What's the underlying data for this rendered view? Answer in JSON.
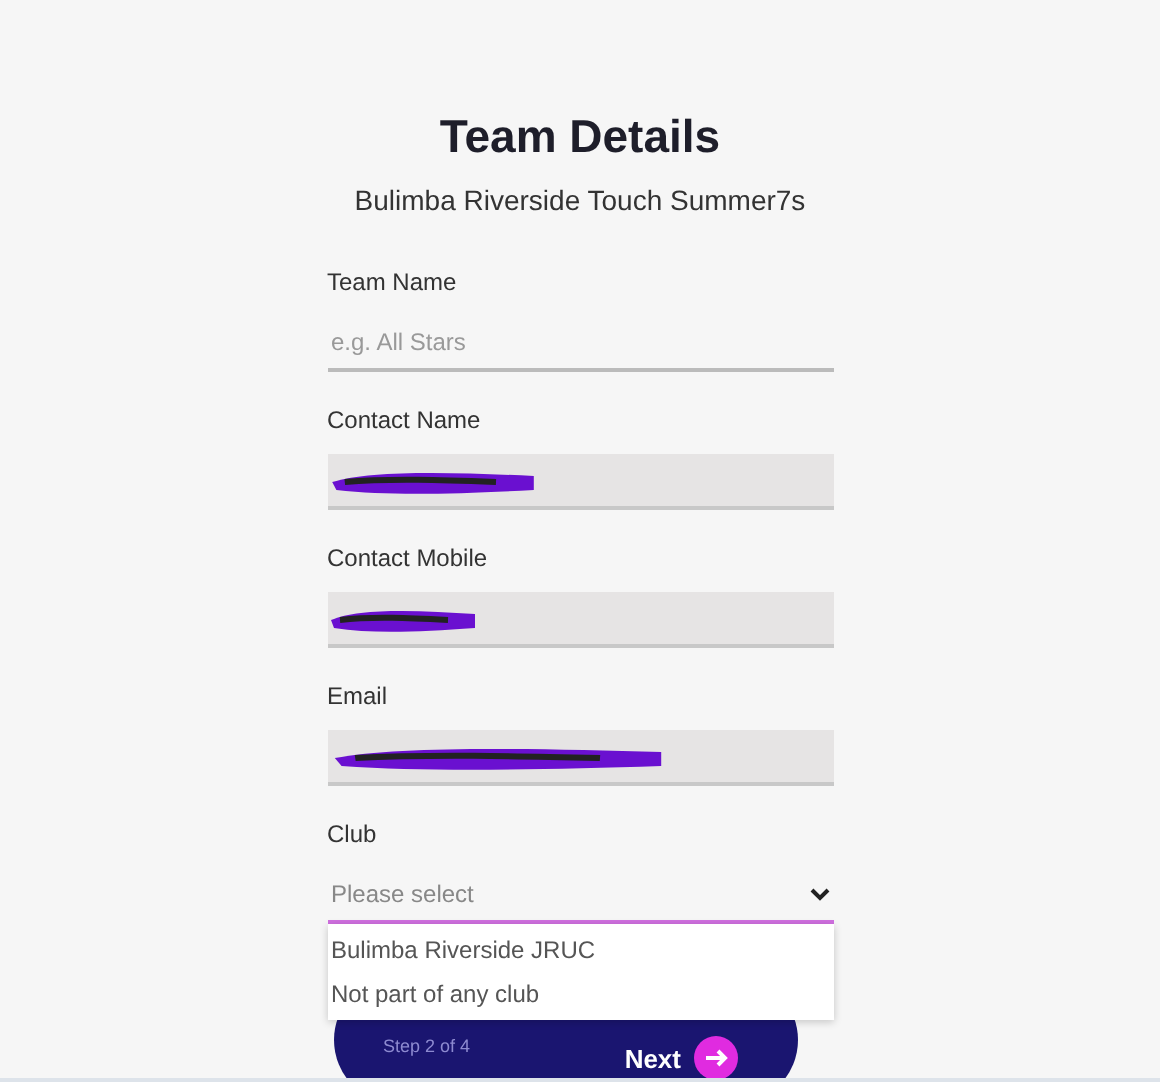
{
  "title": "Team Details",
  "subtitle": "Bulimba Riverside Touch Summer7s",
  "fields": [
    {
      "label": "Team Name",
      "placeholder": "e.g. All Stars",
      "redacted": false
    },
    {
      "label": "Contact Name",
      "redacted": true
    },
    {
      "label": "Contact Mobile",
      "redacted": true
    },
    {
      "label": "Email",
      "redacted": true
    }
  ],
  "club": {
    "label": "Club",
    "placeholder": "Please select",
    "expanded": true,
    "options": [
      "Bulimba Riverside JRUC",
      "Not part of any club"
    ]
  },
  "footer": {
    "step": "Step 2 of 4",
    "next": "Next"
  }
}
